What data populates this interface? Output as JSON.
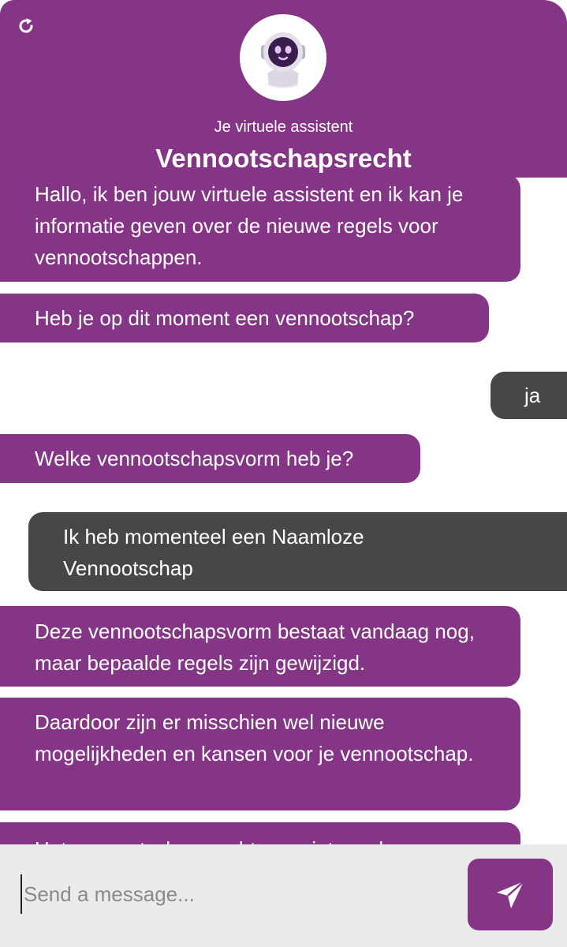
{
  "header": {
    "subtitle": "Je virtuele assistent",
    "title": "Vennootschapsrecht",
    "refresh_icon": "refresh-icon",
    "avatar_icon": "robot-avatar-icon",
    "brand_color": "#843586"
  },
  "messages": [
    {
      "sender": "bot",
      "text": "Hallo, ik ben jouw virtuele assistent en ik kan je informatie geven over de nieuwe regels voor vennootschappen."
    },
    {
      "sender": "bot",
      "text": "Heb je op dit moment een vennootschap?"
    },
    {
      "sender": "user",
      "text": "ja"
    },
    {
      "sender": "bot",
      "text": "Welke vennootschapsvorm heb je?"
    },
    {
      "sender": "user",
      "text": "Ik heb momenteel een Naamloze Vennootschap"
    },
    {
      "sender": "bot",
      "text": "Deze vennootschapsvorm bestaat vandaag nog, maar bepaalde regels zijn gewijzigd."
    },
    {
      "sender": "bot",
      "text": "Daardoor zijn er misschien wel nieuwe mogelijkheden en kansen voor je vennootschap."
    },
    {
      "sender": "bot",
      "text": "Het vennootschapsrecht voorziet vandaag"
    }
  ],
  "composer": {
    "placeholder": "Send a message...",
    "value": "",
    "send_icon": "send-icon"
  },
  "colors": {
    "bot_bubble": "#843586",
    "user_bubble": "#474747",
    "composer_bg": "#ebebeb"
  }
}
